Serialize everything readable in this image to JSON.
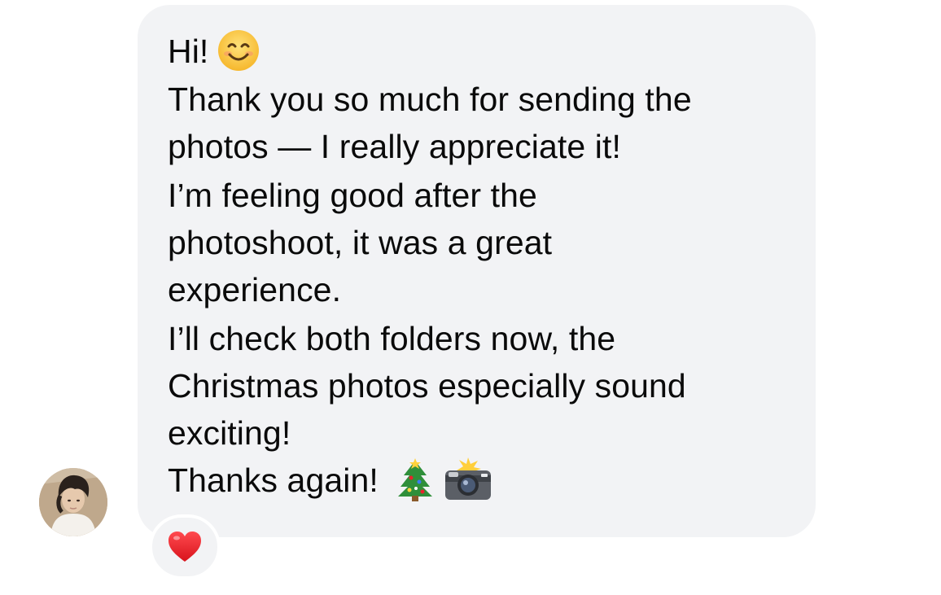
{
  "message": {
    "lines": [
      "Hi!",
      "Thank you so much for sending the",
      "photos — I really appreciate it!",
      "I’m feeling good after the",
      "photoshoot, it was a great",
      "experience.",
      "I’ll check both folders now, the",
      "Christmas photos especially sound",
      "exciting!",
      "Thanks again!"
    ],
    "emojis": {
      "greeting": "smiling-face-icon",
      "closing_1": "christmas-tree-icon",
      "closing_2": "camera-with-flash-icon"
    }
  },
  "reaction": {
    "icon": "red-heart-icon",
    "color": "#e8232c"
  },
  "colors": {
    "bubble_bg": "#f2f3f5",
    "text": "#0a0a0a",
    "page_bg": "#ffffff"
  }
}
